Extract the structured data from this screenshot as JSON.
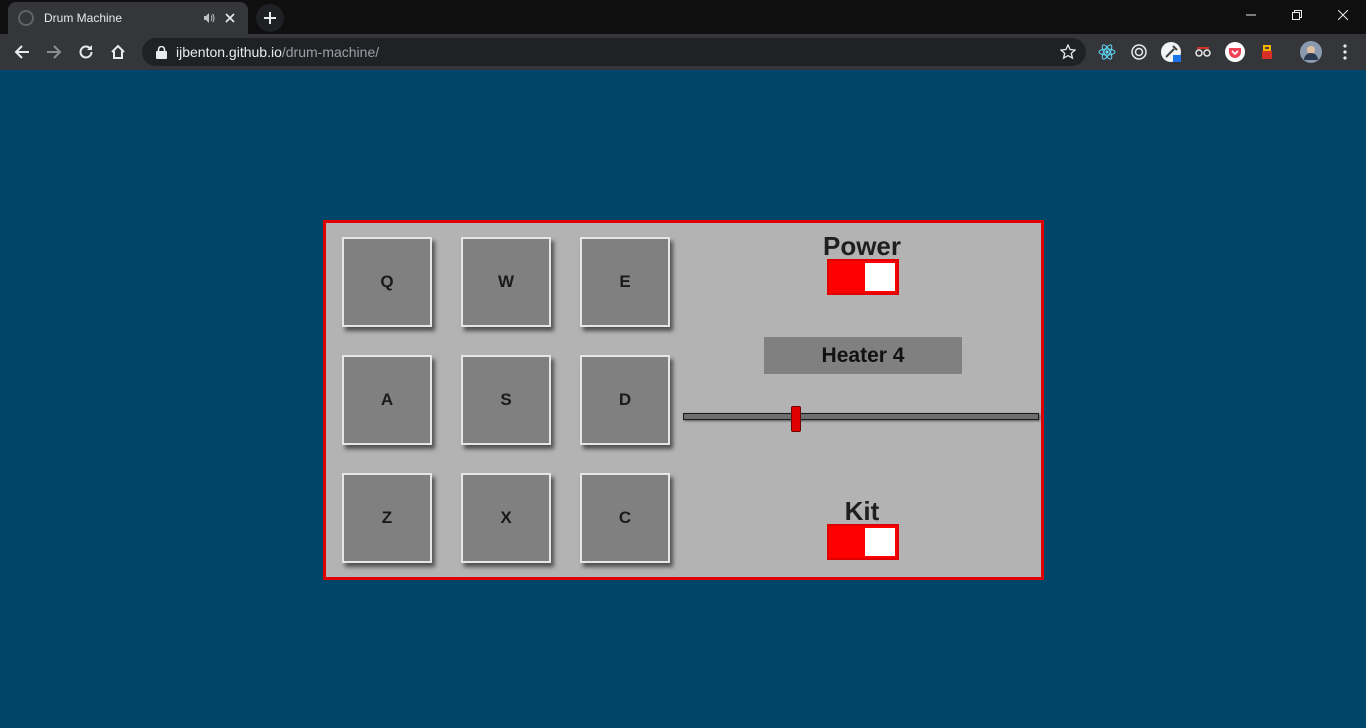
{
  "browser": {
    "tab_title": "Drum Machine",
    "url_host": "ijbenton.github.io",
    "url_path": "/drum-machine/"
  },
  "drum_pads": [
    {
      "key": "Q"
    },
    {
      "key": "W"
    },
    {
      "key": "E"
    },
    {
      "key": "A"
    },
    {
      "key": "S"
    },
    {
      "key": "D"
    },
    {
      "key": "Z"
    },
    {
      "key": "X"
    },
    {
      "key": "C"
    }
  ],
  "controls": {
    "power_label": "Power",
    "power_on": true,
    "display_text": "Heater 4",
    "volume_level": 0.31,
    "kit_label": "Kit",
    "kit_toggle_on": true
  },
  "colors": {
    "page_background": "#00466a",
    "machine_background": "#b3b3b3",
    "accent_red": "#ff0000",
    "pad_gray": "#808080"
  }
}
